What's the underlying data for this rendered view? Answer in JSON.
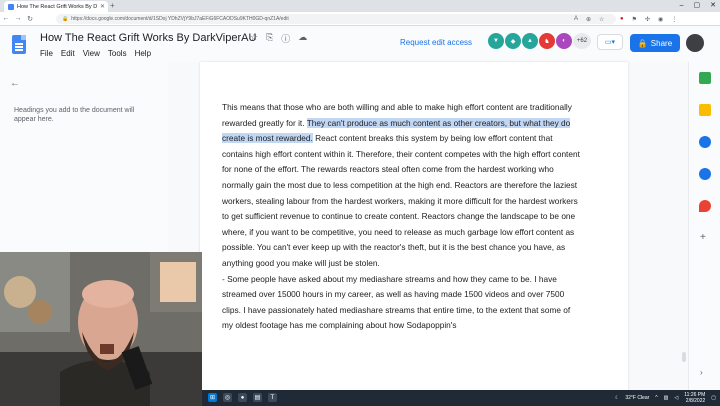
{
  "browser": {
    "tab_title": "How The React Grift Works By D",
    "url": "https://docs.google.com/document/d/1SDoj YDhZVjY9bJ7aEFiG6FCAODSu9KTH0GD-qnZ1A/edit",
    "new_tab_label": "+"
  },
  "docs": {
    "title": "How The React Grift Works By DarkViperAU",
    "menus": [
      "File",
      "Edit",
      "View",
      "Tools",
      "Help"
    ],
    "request_edit": "Request edit access",
    "viewer_count": "+62",
    "share_label": "Share"
  },
  "outline": {
    "hint": "Headings you add to the document will appear here."
  },
  "document": {
    "p1_before": "This means that those who are both willing and able to make high effort content are traditionally rewarded greatly for it. ",
    "p1_highlight": "They can't produce as much content as other creators, but what they do create is most rewarded.",
    "p1_after": " React content breaks this system by being low effort content that contains high effort content within it. Therefore, their content competes with the high effort content for none of the effort. The rewards reactors steal often come from the hardest working who normally gain the most due to less competition at the high end. Reactors are therefore the laziest workers, stealing labour from the hardest workers, making it more difficult for the hardest workers to get sufficient revenue to continue to create content. Reactors change the landscape to be one where, if you want to be competitive, you need to release as much garbage low effort content as possible. You can't ever keep up with the reactor's theft, but it is the best chance you have, as anything good you make will just be stolen.",
    "p2": "- Some people have asked about my mediashare streams and how they came to be. I have streamed over 15000 hours in my career, as well as having made 1500 videos and over 7500 clips. I have passionately hated mediashare streams that entire time, to the extent that some of my oldest footage has me complaining about how Sodapoppin's"
  },
  "taskbar": {
    "weather": "32°F Clear",
    "time": "11:26 PM",
    "date": "2/8/2022"
  },
  "colors": {
    "accent": "#1a73e8",
    "highlight": "#c2d7f4"
  }
}
